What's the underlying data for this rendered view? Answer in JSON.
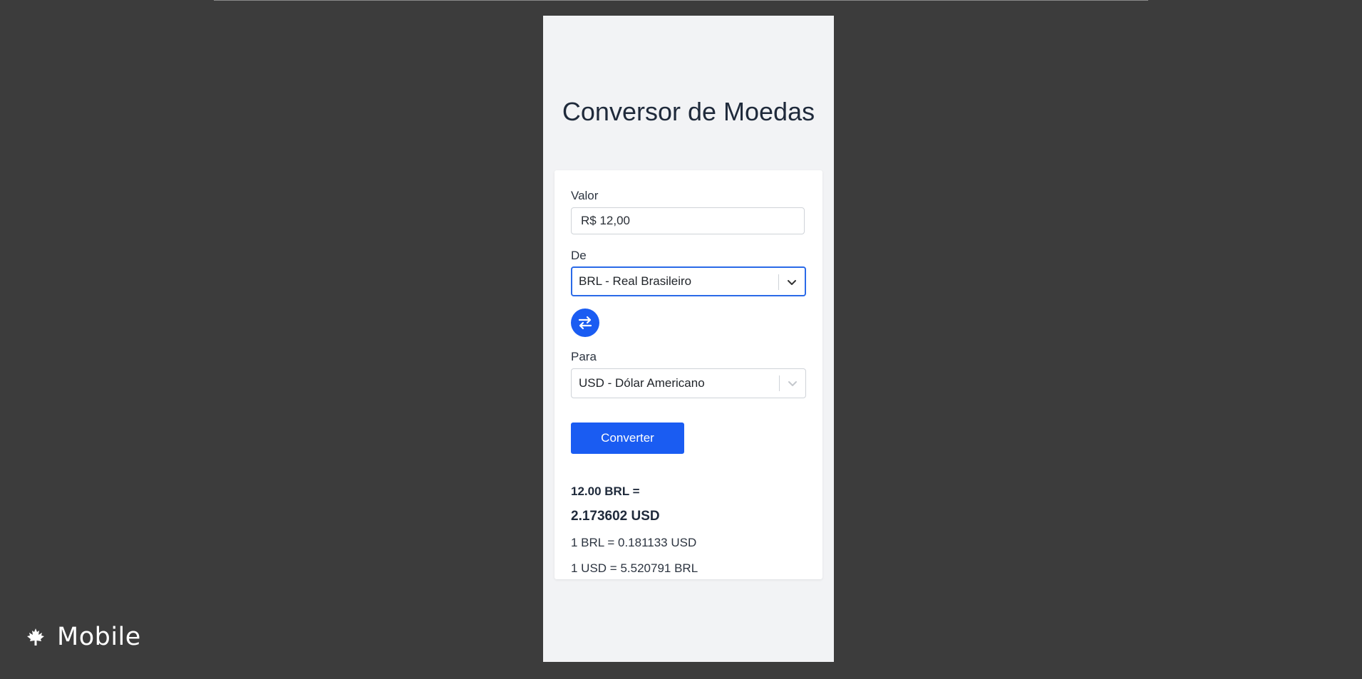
{
  "app": {
    "title": "Conversor de Moedas"
  },
  "form": {
    "amount_label": "Valor",
    "amount_value": "R$ 12,00",
    "from_label": "De",
    "from_value": "BRL - Real Brasileiro",
    "to_label": "Para",
    "to_value": "USD - Dólar Americano",
    "convert_label": "Converter",
    "swap_icon": "swap-arrows-icon"
  },
  "result": {
    "from_text": "12.00 BRL =",
    "to_text": "2.173602 USD",
    "rate_forward": "1 BRL = 0.181133 USD",
    "rate_reverse": "1 USD = 5.520791 BRL"
  },
  "footer_badge": {
    "icon": "maple-leaf-icon",
    "label": "Mobile"
  },
  "colors": {
    "accent": "#1a5cf2",
    "background": "#3c3c3c",
    "phone_background": "#f2f3f5"
  }
}
